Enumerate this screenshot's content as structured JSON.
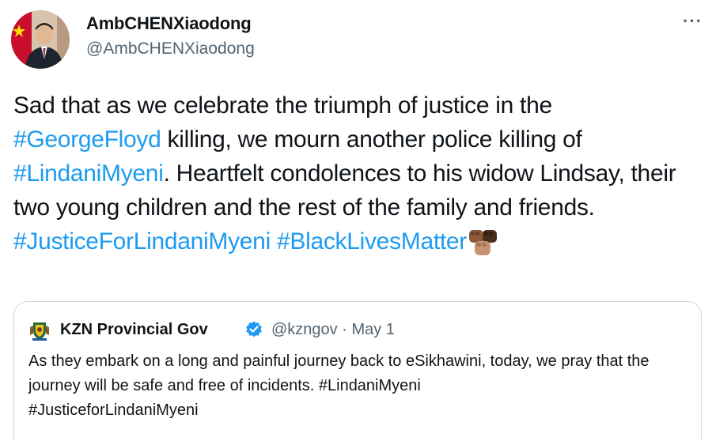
{
  "author": {
    "display_name": "AmbCHENXiaodong",
    "handle": "@AmbCHENXiaodong",
    "avatar_icon": "profile-photo"
  },
  "more_glyph": "···",
  "tweet": {
    "segments": [
      {
        "text": "Sad that as we celebrate the triumph of justice in the ",
        "hashtag": false
      },
      {
        "text": "#GeorgeFloyd",
        "hashtag": true
      },
      {
        "text": " killing, we mourn another police killing of ",
        "hashtag": false
      },
      {
        "text": "#LindaniMyeni",
        "hashtag": true
      },
      {
        "text": ". Heartfelt condolences to his widow Lindsay, their two young children and the rest of the family and friends. ",
        "hashtag": false
      },
      {
        "text": "#JusticeForLindaniMyeni",
        "hashtag": true
      },
      {
        "text": " ",
        "hashtag": false
      },
      {
        "text": "#BlackLivesMatter",
        "hashtag": true
      }
    ],
    "emoji_icon": "raised-fists-emoji"
  },
  "quoted": {
    "display_name": "KZN Provincial Gov",
    "verified_icon": "verified-badge-icon",
    "logo_icon": "kzn-coat-of-arms-icon",
    "handle": "@kzngov",
    "separator": "·",
    "date": "May 1",
    "text_plain": "As they embark on a long and painful journey back to eSikhawini, today, we pray that the journey will be safe and free of incidents. ",
    "hashtag_1": "#LindaniMyeni",
    "hashtag_2": "#JusticeforLindaniMyeni"
  },
  "colors": {
    "link": "#1d9bf0",
    "secondary_text": "#536471",
    "primary_text": "#0f1419",
    "border": "#cfd9de"
  }
}
